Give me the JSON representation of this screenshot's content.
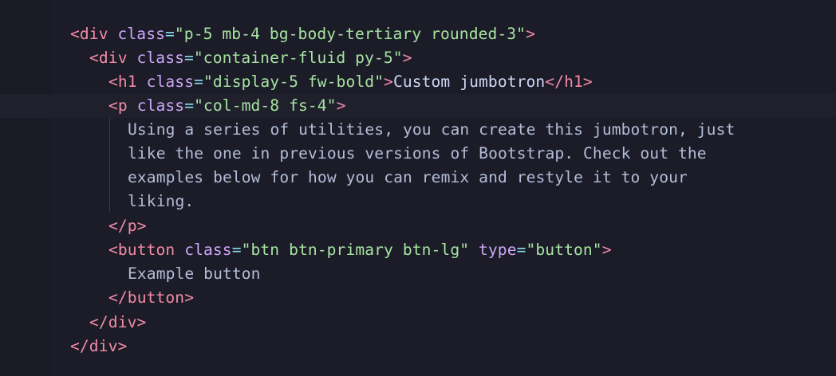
{
  "colors": {
    "background": "#1c1c28",
    "tag": "#f38ba8",
    "attribute": "#cba6f7",
    "string": "#a6e3a1",
    "text": "#cdd6f4"
  },
  "code": {
    "line1": {
      "open": "<",
      "tag": "div",
      "attr1": "class",
      "eq": "=",
      "val1": "\"p-5 mb-4 bg-body-tertiary rounded-3\"",
      "close": ">"
    },
    "line2": {
      "open": "<",
      "tag": "div",
      "attr1": "class",
      "eq": "=",
      "val1": "\"container-fluid py-5\"",
      "close": ">"
    },
    "line3": {
      "open": "<",
      "tag": "h1",
      "attr1": "class",
      "eq": "=",
      "val1": "\"display-5 fw-bold\"",
      "close": ">",
      "text": "Custom jumbotron",
      "endopen": "</",
      "endtag": "h1",
      "endclose": ">"
    },
    "line4": {
      "open": "<",
      "tag": "p",
      "attr1": "class",
      "eq": "=",
      "val1": "\"col-md-8 fs-4\"",
      "close": ">"
    },
    "line5": "Using a series of utilities, you can create this jumbotron, just",
    "line6": "like the one in previous versions of Bootstrap. Check out the",
    "line7": "examples below for how you can remix and restyle it to your",
    "line8": "liking.",
    "line9": {
      "open": "</",
      "tag": "p",
      "close": ">"
    },
    "line10": {
      "open": "<",
      "tag": "button",
      "attr1": "class",
      "eq": "=",
      "val1": "\"btn btn-primary btn-lg\"",
      "attr2": "type",
      "eq2": "=",
      "val2": "\"button\"",
      "close": ">"
    },
    "line11": "Example button",
    "line12": {
      "open": "</",
      "tag": "button",
      "close": ">"
    },
    "line13": {
      "open": "</",
      "tag": "div",
      "close": ">"
    },
    "line14": {
      "open": "</",
      "tag": "div",
      "close": ">"
    }
  }
}
